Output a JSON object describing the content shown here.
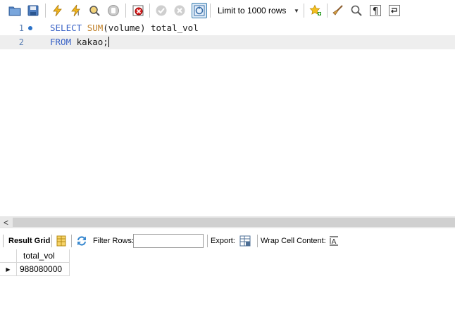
{
  "toolbar": {
    "buttons": [
      {
        "name": "open-sql-file-icon"
      },
      {
        "name": "save-sql-file-icon"
      },
      {
        "name": "execute-all-icon"
      },
      {
        "name": "execute-current-statement-icon"
      },
      {
        "name": "explain-icon"
      },
      {
        "name": "stop-query-icon"
      },
      {
        "name": "toggle-continue-on-error-icon"
      },
      {
        "name": "commit-icon"
      },
      {
        "name": "rollback-icon"
      },
      {
        "name": "toggle-autocommit-icon"
      },
      {
        "name": "add-snippet-icon"
      },
      {
        "name": "beautify-icon"
      },
      {
        "name": "find-icon"
      },
      {
        "name": "toggle-invisible-characters-icon"
      },
      {
        "name": "toggle-word-wrap-icon"
      }
    ],
    "limit_select": "Limit to 1000 rows"
  },
  "editor": {
    "lines": [
      {
        "number": "1",
        "kw1": "SELECT",
        "fn": "SUM",
        "rest": "(volume) total_vol"
      },
      {
        "number": "2",
        "kw1": "FROM",
        "rest": " kakao;"
      }
    ]
  },
  "result_bar": {
    "result_grid_label": "Result Grid",
    "filter_label": "Filter Rows:",
    "filter_value": "",
    "export_label": "Export:",
    "wrap_label": "Wrap Cell Content:"
  },
  "grid": {
    "columns": [
      "total_vol"
    ],
    "rows": [
      [
        "988080000"
      ]
    ]
  },
  "colors": {
    "keyword": "#3a63c6",
    "function": "#c08028",
    "line_number": "#5b7fb3",
    "active_line": "#eeeeee"
  }
}
